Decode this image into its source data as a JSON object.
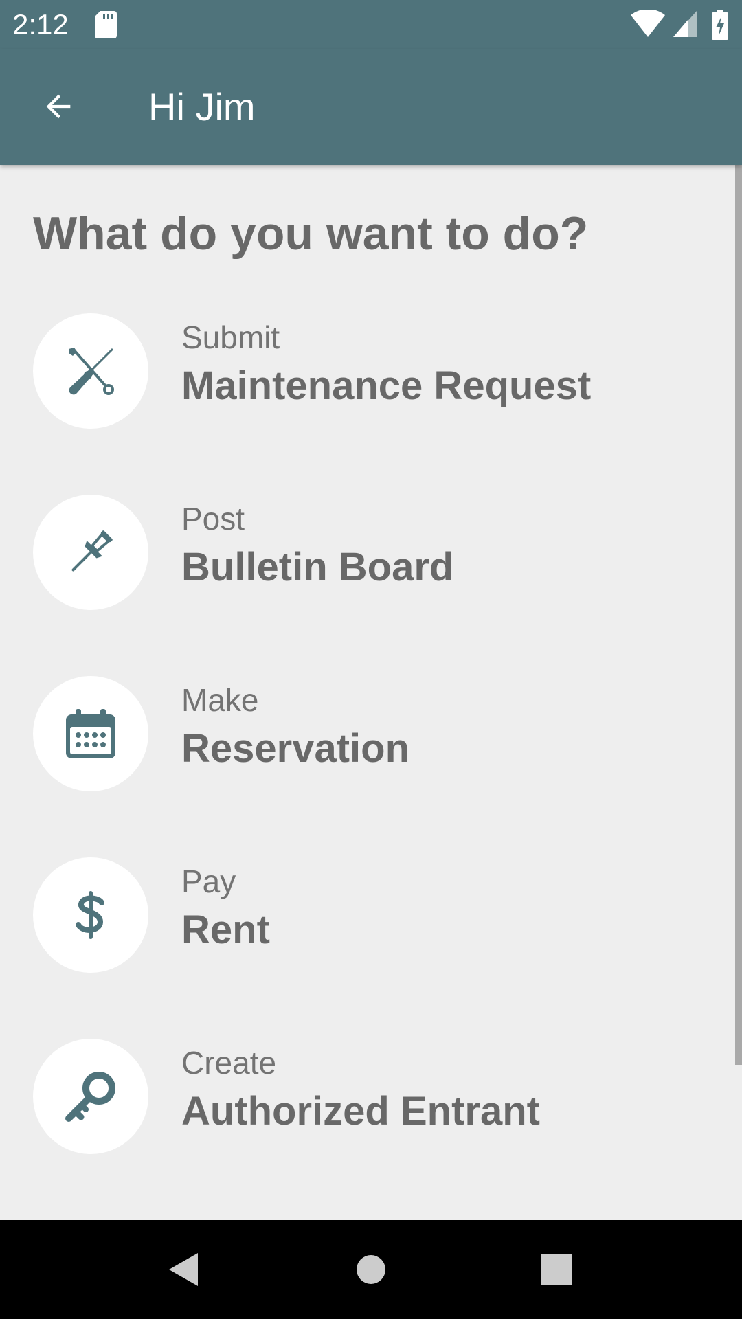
{
  "status_bar": {
    "time": "2:12",
    "icons": [
      "sd-card-icon",
      "wifi-icon",
      "signal-icon",
      "battery-charging-icon"
    ]
  },
  "app_bar": {
    "title": "Hi Jim",
    "back_icon": "arrow-back-icon"
  },
  "content": {
    "heading": "What do you want to do?",
    "actions": [
      {
        "verb": "Submit",
        "object": "Maintenance Request",
        "icon": "tools-icon"
      },
      {
        "verb": "Post",
        "object": "Bulletin Board",
        "icon": "pushpin-icon"
      },
      {
        "verb": "Make",
        "object": "Reservation",
        "icon": "calendar-icon"
      },
      {
        "verb": "Pay",
        "object": "Rent",
        "icon": "dollar-icon"
      },
      {
        "verb": "Create",
        "object": "Authorized Entrant",
        "icon": "key-icon"
      }
    ]
  },
  "nav_bar": {
    "buttons": [
      "nav-back-icon",
      "nav-home-icon",
      "nav-recents-icon"
    ]
  },
  "colors": {
    "primary": "#4f737b",
    "icon": "#4f737b",
    "background": "#eeeeee",
    "text": "#686868"
  }
}
